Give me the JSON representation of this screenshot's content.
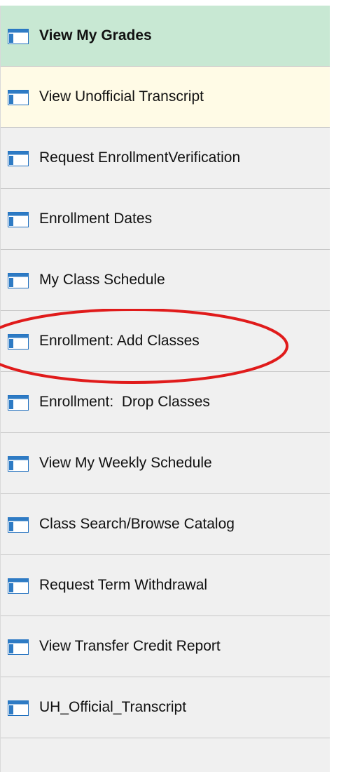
{
  "menu": {
    "items": [
      {
        "label": "View My Grades",
        "state": "active"
      },
      {
        "label": "View Unofficial Transcript",
        "state": "hover"
      },
      {
        "label": "Request EnrollmentVerification",
        "state": "normal"
      },
      {
        "label": "Enrollment Dates",
        "state": "normal"
      },
      {
        "label": "My Class Schedule",
        "state": "normal"
      },
      {
        "label": "Enrollment: Add Classes",
        "state": "normal"
      },
      {
        "label": "Enrollment:  Drop Classes",
        "state": "normal"
      },
      {
        "label": "View My Weekly Schedule",
        "state": "normal"
      },
      {
        "label": "Class Search/Browse Catalog",
        "state": "normal"
      },
      {
        "label": "Request Term Withdrawal",
        "state": "normal"
      },
      {
        "label": "View Transfer Credit Report",
        "state": "normal"
      },
      {
        "label": "UH_Official_Transcript",
        "state": "normal"
      }
    ],
    "item_icon": "window-icon"
  },
  "annotation": {
    "type": "red-ellipse",
    "color": "#e01b1b",
    "target": "Enrollment: Add Classes"
  },
  "colors": {
    "active_bg": "#c8e8d3",
    "hover_bg": "#fffbe6",
    "menu_bg": "#f0f0f0",
    "icon_blue": "#1f6fbf"
  }
}
